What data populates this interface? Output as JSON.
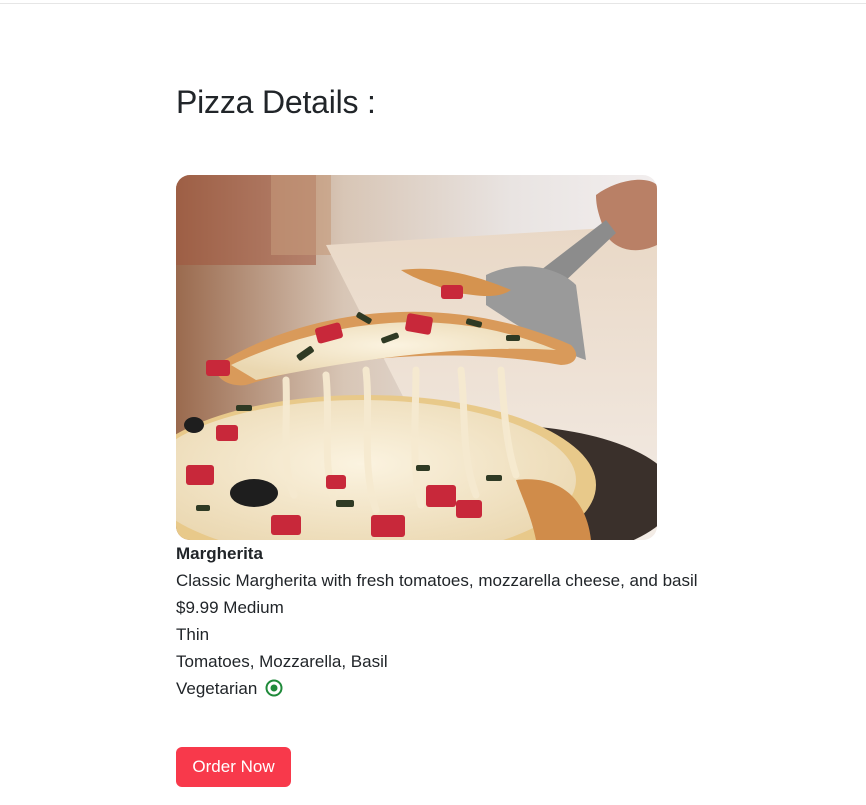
{
  "page": {
    "title": "Pizza Details :"
  },
  "pizza": {
    "name": "Margherita",
    "description": "Classic Margherita with fresh tomatoes, mozzarella cheese, and basil",
    "price": "$9.99",
    "size": "Medium",
    "crust": "Thin",
    "toppings": "Tomatoes, Mozzarella, Basil",
    "diet_label": "Vegetarian",
    "diet_icon": "veg-indicator-icon"
  },
  "actions": {
    "order_label": "Order Now"
  },
  "colors": {
    "accent": "#f8394b",
    "veg_indicator": "#1f8a3a",
    "text": "#212529"
  }
}
